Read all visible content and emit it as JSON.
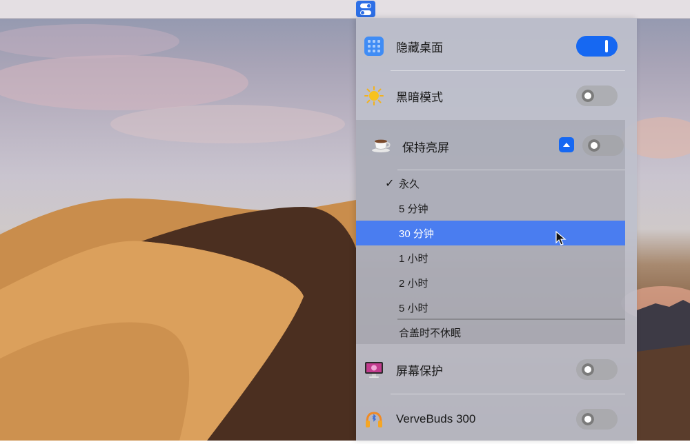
{
  "menubar": {
    "icon": "toggle-switches-icon"
  },
  "panel": {
    "rows": [
      {
        "label": "隐藏桌面",
        "icon": "grid-icon",
        "toggle": "on"
      },
      {
        "label": "黑暗模式",
        "icon": "sun-icon",
        "toggle": "off"
      },
      {
        "label": "屏幕保护",
        "icon": "monitor-icon",
        "toggle": "off"
      },
      {
        "label": "VerveBuds 300",
        "icon": "headphones-icon",
        "toggle": "off"
      }
    ],
    "keep_awake": {
      "label": "保持亮屏",
      "icon": "coffee-cup-icon",
      "toggle": "off",
      "options": [
        "永久",
        "5 分钟",
        "30 分钟",
        "1 小时",
        "2 小时",
        "5 小时"
      ],
      "checked_option": "永久",
      "highlighted_option": "30 分钟",
      "check_mark": "✓",
      "lid_option": "合盖时不休眠"
    }
  },
  "colors": {
    "accent": "#1668f2",
    "highlight": "#4a7df0"
  }
}
